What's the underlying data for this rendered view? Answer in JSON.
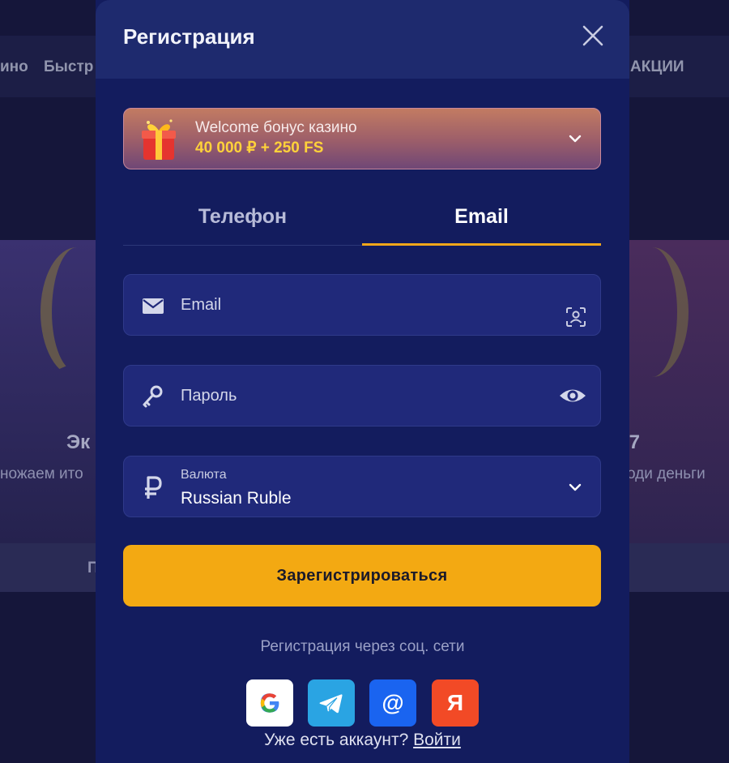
{
  "background": {
    "nav_items": [
      "ино",
      "Быстр",
      "АКЦИИ"
    ],
    "left_heading": "Эк",
    "left_text": "ножаем ито",
    "left_strip_text": "П",
    "right_heading": "/7",
    "right_text": "оди деньги"
  },
  "modal": {
    "title": "Регистрация",
    "close_icon": "close-icon"
  },
  "bonus": {
    "line1": "Welcome бонус казино",
    "line2": "40 000 ₽ + 250 FS",
    "icon": "gift-icon"
  },
  "tabs": [
    {
      "label": "Телефон",
      "active": false
    },
    {
      "label": "Email",
      "active": true
    }
  ],
  "form": {
    "email": {
      "placeholder": "Email",
      "icon": "mail-icon"
    },
    "password": {
      "placeholder": "Пароль",
      "icon": "key-icon"
    },
    "currency": {
      "label": "Валюта",
      "value": "Russian Ruble",
      "icon": "ruble-icon"
    },
    "submit_label": "Зарегистрироваться"
  },
  "social": {
    "caption": "Регистрация через соц. сети",
    "providers": [
      {
        "id": "google",
        "glyph": "G"
      },
      {
        "id": "telegram",
        "glyph": ""
      },
      {
        "id": "mail",
        "glyph": "@"
      },
      {
        "id": "yandex",
        "glyph": "Я"
      }
    ]
  },
  "login": {
    "prompt": "Уже есть аккаунт?",
    "link": "Войти"
  },
  "colors": {
    "accent": "#f3a912",
    "modal_bg": "#131c5e",
    "field_bg": "#20297a",
    "bonus_amount": "#ffd23a"
  }
}
